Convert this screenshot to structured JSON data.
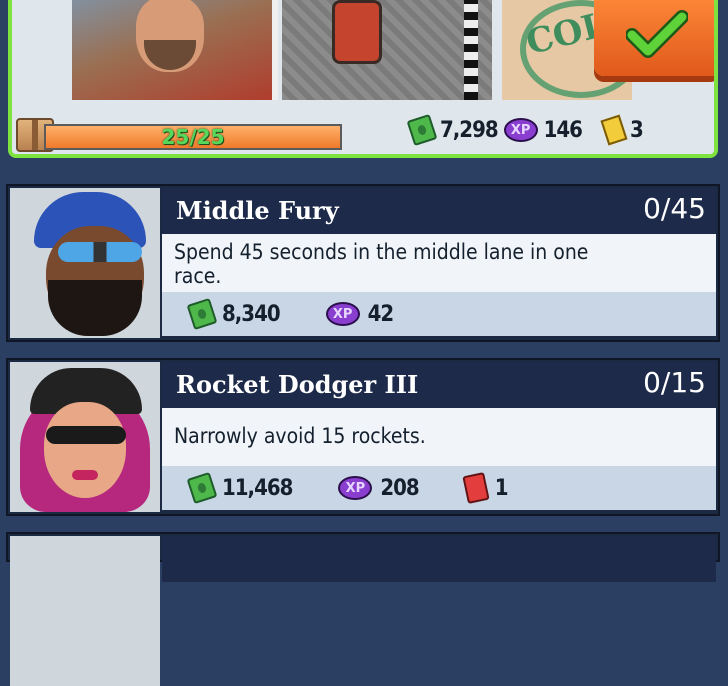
{
  "top_panel": {
    "stamp_text": "COL",
    "progress_label": "25/25",
    "progress_fraction": 1.0,
    "rewards": [
      {
        "icon": "cash-icon",
        "amount": "7,298"
      },
      {
        "icon": "xp-icon",
        "amount": "146"
      },
      {
        "icon": "ticket-icon",
        "amount": "3"
      }
    ]
  },
  "xp_badge": "XP",
  "missions": [
    {
      "title": "Middle Fury",
      "progress": "0/45",
      "description": "Spend 45 seconds in the middle lane in one race.",
      "rewards": [
        {
          "icon": "cash-icon",
          "amount": "8,340"
        },
        {
          "icon": "xp-icon",
          "amount": "42"
        }
      ]
    },
    {
      "title": "Rocket Dodger III",
      "progress": "0/15",
      "description": "Narrowly avoid 15 rockets.",
      "rewards": [
        {
          "icon": "cash-icon",
          "amount": "11,468"
        },
        {
          "icon": "xp-icon",
          "amount": "208"
        },
        {
          "icon": "fuel-can-icon",
          "amount": "1"
        }
      ]
    }
  ],
  "colors": {
    "background": "#2b3f63",
    "panel_border": "#7fe33f",
    "collect_button": "#e0591b",
    "title_bar": "#1d2a4a",
    "reward_strip": "#c9d6e6"
  }
}
